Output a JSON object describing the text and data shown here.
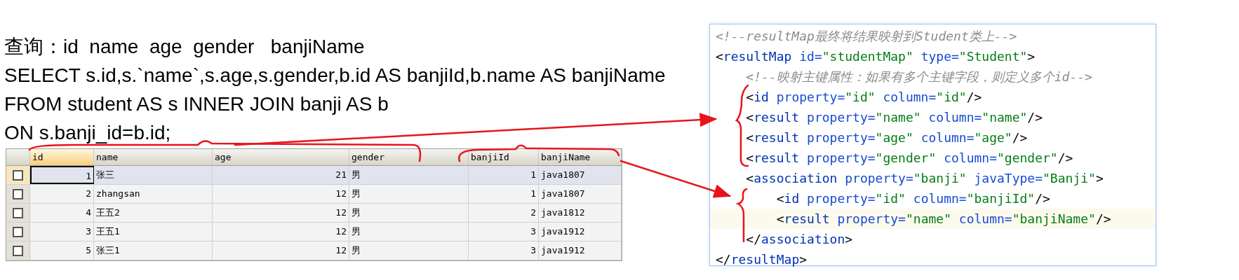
{
  "query_text": [
    "查询：id  name  age  gender   banjiName",
    "SELECT s.id,s.`name`,s.age,s.gender,b.id AS banjiId,b.name AS banjiName",
    "FROM student AS s INNER JOIN banji AS b",
    "ON s.banji_id=b.id;"
  ],
  "table": {
    "columns": [
      {
        "label": "id",
        "active": true
      },
      {
        "label": "name",
        "active": false
      },
      {
        "label": "age",
        "active": false
      },
      {
        "label": "gender",
        "active": false
      },
      {
        "label": "banjiId",
        "active": false
      },
      {
        "label": "banjiName",
        "active": false
      }
    ],
    "rows": [
      {
        "selected": true,
        "checked": false,
        "cells": [
          "1",
          "张三",
          "21",
          "男",
          "1",
          "java1807"
        ]
      },
      {
        "selected": false,
        "checked": false,
        "cells": [
          "2",
          "zhangsan",
          "12",
          "男",
          "1",
          "java1807"
        ]
      },
      {
        "selected": false,
        "checked": false,
        "cells": [
          "4",
          "王五2",
          "12",
          "男",
          "2",
          "java1812"
        ]
      },
      {
        "selected": false,
        "checked": false,
        "cells": [
          "3",
          "王五1",
          "12",
          "男",
          "3",
          "java1912"
        ]
      },
      {
        "selected": false,
        "checked": false,
        "cells": [
          "5",
          "张三1",
          "12",
          "男",
          "3",
          "java1912"
        ]
      }
    ]
  },
  "code_editor": {
    "lines": [
      {
        "current": false,
        "tokens": [
          {
            "kind": "comment",
            "text": "<!--resultMap最终将结果映射到Student类上-->"
          }
        ]
      },
      {
        "current": false,
        "tokens": [
          {
            "kind": "punct",
            "text": "<"
          },
          {
            "kind": "tag",
            "text": "resultMap "
          },
          {
            "kind": "attr",
            "text": "id="
          },
          {
            "kind": "value",
            "text": "\"studentMap\" "
          },
          {
            "kind": "attr",
            "text": "type="
          },
          {
            "kind": "value",
            "text": "\"Student\""
          },
          {
            "kind": "punct",
            "text": ">"
          }
        ]
      },
      {
        "current": false,
        "tokens": [
          {
            "kind": "comment",
            "text": "    <!--映射主键属性：如果有多个主键字段，则定义多个id-->"
          }
        ]
      },
      {
        "current": false,
        "tokens": [
          {
            "kind": "punct",
            "text": "    <"
          },
          {
            "kind": "tag",
            "text": "id "
          },
          {
            "kind": "attr",
            "text": "property="
          },
          {
            "kind": "value",
            "text": "\"id\" "
          },
          {
            "kind": "attr",
            "text": "column="
          },
          {
            "kind": "value",
            "text": "\"id\""
          },
          {
            "kind": "punct",
            "text": "/>"
          }
        ]
      },
      {
        "current": false,
        "tokens": [
          {
            "kind": "punct",
            "text": "    <"
          },
          {
            "kind": "tag",
            "text": "result "
          },
          {
            "kind": "attr",
            "text": "property="
          },
          {
            "kind": "value",
            "text": "\"name\" "
          },
          {
            "kind": "attr",
            "text": "column="
          },
          {
            "kind": "value",
            "text": "\"name\""
          },
          {
            "kind": "punct",
            "text": "/>"
          }
        ]
      },
      {
        "current": false,
        "tokens": [
          {
            "kind": "punct",
            "text": "    <"
          },
          {
            "kind": "tag",
            "text": "result "
          },
          {
            "kind": "attr",
            "text": "property="
          },
          {
            "kind": "value",
            "text": "\"age\" "
          },
          {
            "kind": "attr",
            "text": "column="
          },
          {
            "kind": "value",
            "text": "\"age\""
          },
          {
            "kind": "punct",
            "text": "/>"
          }
        ]
      },
      {
        "current": false,
        "tokens": [
          {
            "kind": "punct",
            "text": "    <"
          },
          {
            "kind": "tag",
            "text": "result "
          },
          {
            "kind": "attr",
            "text": "property="
          },
          {
            "kind": "value",
            "text": "\"gender\" "
          },
          {
            "kind": "attr",
            "text": "column="
          },
          {
            "kind": "value",
            "text": "\"gender\""
          },
          {
            "kind": "punct",
            "text": "/>"
          }
        ]
      },
      {
        "current": false,
        "tokens": [
          {
            "kind": "punct",
            "text": "    <"
          },
          {
            "kind": "tag",
            "text": "association "
          },
          {
            "kind": "attr",
            "text": "property="
          },
          {
            "kind": "value",
            "text": "\"banji\" "
          },
          {
            "kind": "attr",
            "text": "javaType="
          },
          {
            "kind": "value",
            "text": "\"Banji\""
          },
          {
            "kind": "punct",
            "text": ">"
          }
        ]
      },
      {
        "current": false,
        "tokens": [
          {
            "kind": "punct",
            "text": "        <"
          },
          {
            "kind": "tag",
            "text": "id "
          },
          {
            "kind": "attr",
            "text": "property="
          },
          {
            "kind": "value",
            "text": "\"id\" "
          },
          {
            "kind": "attr",
            "text": "column="
          },
          {
            "kind": "value",
            "text": "\"banjiId\""
          },
          {
            "kind": "punct",
            "text": "/>"
          }
        ]
      },
      {
        "current": true,
        "tokens": [
          {
            "kind": "punct",
            "text": "        <"
          },
          {
            "kind": "tag",
            "text": "result "
          },
          {
            "kind": "attr",
            "text": "property="
          },
          {
            "kind": "value",
            "text": "\"name\" "
          },
          {
            "kind": "attr",
            "text": "column="
          },
          {
            "kind": "value",
            "text": "\"banjiName\""
          },
          {
            "kind": "punct",
            "text": "/>"
          }
        ]
      },
      {
        "current": false,
        "tokens": [
          {
            "kind": "punct",
            "text": "    </"
          },
          {
            "kind": "tag",
            "text": "association"
          },
          {
            "kind": "punct",
            "text": ">"
          }
        ]
      },
      {
        "current": false,
        "tokens": [
          {
            "kind": "punct",
            "text": "</"
          },
          {
            "kind": "tag",
            "text": "resultMap"
          },
          {
            "kind": "punct",
            "text": ">"
          }
        ]
      }
    ]
  }
}
